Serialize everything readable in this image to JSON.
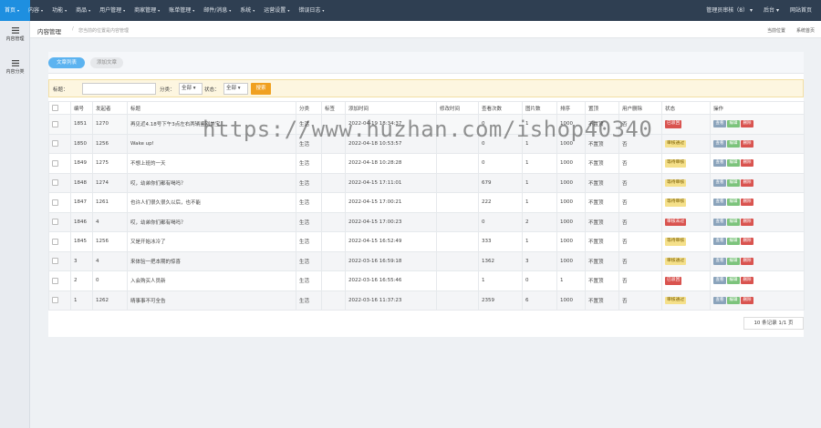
{
  "topnav": {
    "items": [
      {
        "label": "首页",
        "active": true
      },
      {
        "label": "内容"
      },
      {
        "label": "功能"
      },
      {
        "label": "商品"
      },
      {
        "label": "用户管理"
      },
      {
        "label": "商家管理"
      },
      {
        "label": "账单管理"
      },
      {
        "label": "邮件/消息"
      },
      {
        "label": "系统"
      },
      {
        "label": "运营设置"
      },
      {
        "label": "错误日志"
      }
    ],
    "right": [
      "管理员审核（8）",
      "后台",
      "网站首页"
    ]
  },
  "sidebar": {
    "items": [
      {
        "label": "内容管理"
      },
      {
        "label": "内容分类"
      }
    ]
  },
  "breadcrumb": {
    "current": "内容管理",
    "sep": "/",
    "sub": "您当前的位置是内容管理",
    "right1": "当前位置",
    "right2": "系统首页"
  },
  "tabs": [
    "文章列表",
    "添加文章"
  ],
  "filter": {
    "title_label": "标题：",
    "category_label": "分类：",
    "category_value": "全部",
    "status_label": "状态：",
    "status_value": "全部",
    "search_button": "搜索"
  },
  "table": {
    "headers": [
      "",
      "编号",
      "发起者",
      "标题",
      "分类",
      "标签",
      "添加时间",
      "修改时间",
      "查看次数",
      "图片数",
      "排序",
      "置顶",
      "用户删除",
      "状态",
      "操作"
    ],
    "rows": [
      {
        "id": "1851",
        "author": "1270",
        "title": "再见近4.18号下午3点左右两辆鉴别美宝...",
        "category": "生活",
        "tag": "",
        "created": "2022-04-19 18:34:37",
        "modified": "",
        "views": "0",
        "pics": "1",
        "sort": "1000",
        "top": "不置顶",
        "deleted": "否",
        "status": "已驳回",
        "status_color": "red"
      },
      {
        "id": "1850",
        "author": "1256",
        "title": "Wake up!",
        "category": "生活",
        "tag": "",
        "created": "2022-04-18 10:53:57",
        "modified": "",
        "views": "0",
        "pics": "1",
        "sort": "1000",
        "top": "不置顶",
        "deleted": "否",
        "status": "审核通过",
        "status_color": "yellow"
      },
      {
        "id": "1849",
        "author": "1275",
        "title": "不想上班的一天",
        "category": "生活",
        "tag": "",
        "created": "2022-04-18 10:28:28",
        "modified": "",
        "views": "0",
        "pics": "1",
        "sort": "1000",
        "top": "不置顶",
        "deleted": "否",
        "status": "等待审核",
        "status_color": "yellow"
      },
      {
        "id": "1848",
        "author": "1274",
        "title": "哎，幼弟你们都有喝吗？",
        "category": "生活",
        "tag": "",
        "created": "2022-04-15 17:11:01",
        "modified": "",
        "views": "679",
        "pics": "1",
        "sort": "1000",
        "top": "不置顶",
        "deleted": "否",
        "status": "等待审核",
        "status_color": "yellow"
      },
      {
        "id": "1847",
        "author": "1261",
        "title": "也许人们很久很久以后，也不能",
        "category": "生活",
        "tag": "",
        "created": "2022-04-15 17:00:21",
        "modified": "",
        "views": "222",
        "pics": "1",
        "sort": "1000",
        "top": "不置顶",
        "deleted": "否",
        "status": "等待审核",
        "status_color": "yellow"
      },
      {
        "id": "1846",
        "author": "4",
        "title": "哎，幼弟你们都有喝吗？",
        "category": "生活",
        "tag": "",
        "created": "2022-04-15 17:00:23",
        "modified": "",
        "views": "0",
        "pics": "2",
        "sort": "1000",
        "top": "不置顶",
        "deleted": "否",
        "status": "审核未过",
        "status_color": "red"
      },
      {
        "id": "1845",
        "author": "1256",
        "title": "又是开始冰冷了",
        "category": "生活",
        "tag": "",
        "created": "2022-04-15 16:52:49",
        "modified": "",
        "views": "333",
        "pics": "1",
        "sort": "1000",
        "top": "不置顶",
        "deleted": "否",
        "status": "等待审核",
        "status_color": "yellow"
      },
      {
        "id": "3",
        "author": "4",
        "title": "来体验一把本期的惊喜",
        "category": "生活",
        "tag": "",
        "created": "2022-03-16 16:59:18",
        "modified": "",
        "views": "1362",
        "pics": "3",
        "sort": "1000",
        "top": "不置顶",
        "deleted": "否",
        "status": "审核通过",
        "status_color": "yellow"
      },
      {
        "id": "2",
        "author": "0",
        "title": "入会购买人员新",
        "category": "生活",
        "tag": "",
        "created": "2022-03-16 16:55:46",
        "modified": "",
        "views": "1",
        "pics": "0",
        "sort": "1",
        "top": "不置顶",
        "deleted": "否",
        "status": "已驳回",
        "status_color": "red"
      },
      {
        "id": "1",
        "author": "1262",
        "title": "晴事事不可全告",
        "category": "生活",
        "tag": "",
        "created": "2022-03-16 11:37:23",
        "modified": "",
        "views": "2359",
        "pics": "6",
        "sort": "1000",
        "top": "不置顶",
        "deleted": "否",
        "status": "审核通过",
        "status_color": "yellow"
      }
    ],
    "ops": [
      "查看",
      "编辑",
      "删除"
    ]
  },
  "pager": "10 条记录 1/1 页",
  "watermark": "https://www.huzhan.com/ishop40340"
}
